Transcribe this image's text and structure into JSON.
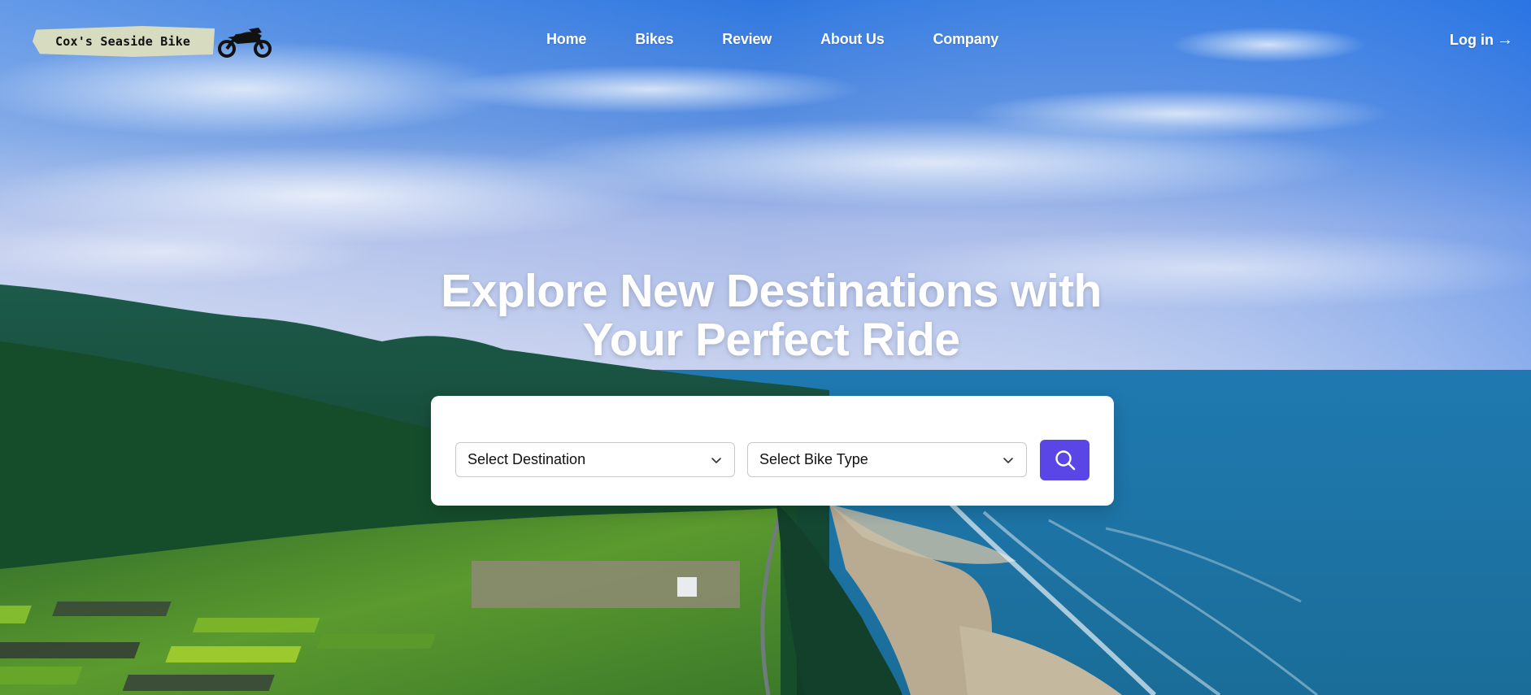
{
  "brand": {
    "name": "Cox's Seaside Bike"
  },
  "nav": {
    "items": [
      {
        "label": "Home"
      },
      {
        "label": "Bikes"
      },
      {
        "label": "Review"
      },
      {
        "label": "About Us"
      },
      {
        "label": "Company"
      }
    ],
    "login_label": "Log in",
    "login_arrow": "→"
  },
  "hero": {
    "title_line1": "Explore New Destinations with",
    "title_line2": "Your Perfect Ride"
  },
  "search": {
    "destination_placeholder": "Select Destination",
    "bike_type_placeholder": "Select Bike Type",
    "button_icon": "search-icon"
  },
  "colors": {
    "accent": "#5a45e6",
    "logo_badge": "#d7dcc1",
    "sky_top": "#2f7ee6",
    "ocean": "#1b6fa0"
  }
}
